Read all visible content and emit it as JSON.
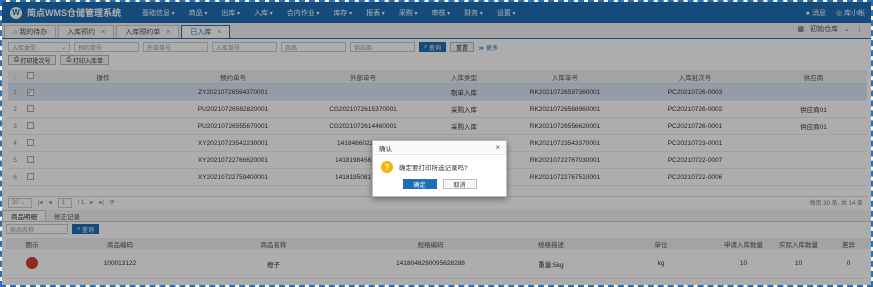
{
  "app": {
    "title": "简点WMS仓储管理系统",
    "logo_glyph": "W"
  },
  "menu": [
    "基础信息",
    "商品",
    "出库",
    "入库",
    "合内作业",
    "库存",
    "报表",
    "采购",
    "审核",
    "财务",
    "设置"
  ],
  "top_right": {
    "messages": "消息",
    "user": "库小帐"
  },
  "tabs": [
    {
      "label": "我的待办",
      "icon": "home-icon"
    },
    {
      "label": "入库预约"
    },
    {
      "label": "入库预约单"
    },
    {
      "label": "已入库",
      "active": true
    }
  ],
  "warehouse": {
    "label": "初始仓库"
  },
  "filters": {
    "inbound_type": "入库类型",
    "pre_no": "预约单号",
    "ext_no": "外部单号",
    "in_no": "入库单号",
    "goods": "商品",
    "supplier": "供应商",
    "search": "查询",
    "reset": "重置",
    "more": "更多"
  },
  "actions": {
    "print_batch": "打印批次号",
    "print_inbound": "打印入库单"
  },
  "grid": {
    "columns": [
      "操作",
      "预约单号",
      "外部单号",
      "入库类型",
      "入库单号",
      "入库批次号",
      "供应商"
    ],
    "rows": [
      {
        "idx": "1",
        "pre": "ZY20210726594370001",
        "ext": "",
        "type": "制单入库",
        "in": "RK20210726597360001",
        "batch": "PC20210726-0003",
        "sup": "",
        "checked": true
      },
      {
        "idx": "2",
        "pre": "PU20210726562820001",
        "ext": "CG20210726153700​01",
        "type": "采购入库",
        "in": "RK20210726568960001",
        "batch": "PC20210726-0002",
        "sup": "供应商01"
      },
      {
        "idx": "3",
        "pre": "PU20210726555670001",
        "ext": "CG20210726144600​01",
        "type": "采购入库",
        "in": "RK20210726556620001",
        "batch": "PC20210726-0001",
        "sup": "供应商01"
      },
      {
        "idx": "4",
        "pre": "XY20210723542230001",
        "ext": "1418466022112...",
        "type": "",
        "in": "RK20210723543370001",
        "batch": "PC20210723-0001",
        "sup": ""
      },
      {
        "idx": "5",
        "pre": "XY20210722766620001",
        "ext": "14181984561247...",
        "type": "",
        "in": "RK20210722767030001",
        "batch": "PC20210722-0007",
        "sup": ""
      },
      {
        "idx": "6",
        "pre": "XY20210722759400001",
        "ext": "14181950817820...",
        "type": "",
        "in": "RK20210722767510001",
        "batch": "PC20210722-0006",
        "sup": ""
      }
    ]
  },
  "pager": {
    "page_size": "30",
    "page": "1",
    "total_pages": "/ 1",
    "info": "每页 30 条, 共 14 条"
  },
  "subtabs": {
    "detail": "商品明细",
    "history": "修正记录"
  },
  "sub_filter": {
    "goods_name": "商品名称",
    "search": "查询"
  },
  "detail": {
    "columns": [
      "图示",
      "商品编码",
      "商品名称",
      "规格编码",
      "规格描述",
      "单位",
      "申请入库数量",
      "实际入库数量",
      "差异"
    ],
    "rows": [
      {
        "code": "100013122",
        "name": "橙子",
        "spec_code": "1418048290095628288",
        "spec_desc": "重量:5kg",
        "unit": "kg",
        "req": "10",
        "act": "10",
        "diff": "0"
      }
    ]
  },
  "dialog": {
    "title": "确认",
    "message": "确定要打印所选记录吗?",
    "ok": "确定",
    "cancel": "取消"
  }
}
